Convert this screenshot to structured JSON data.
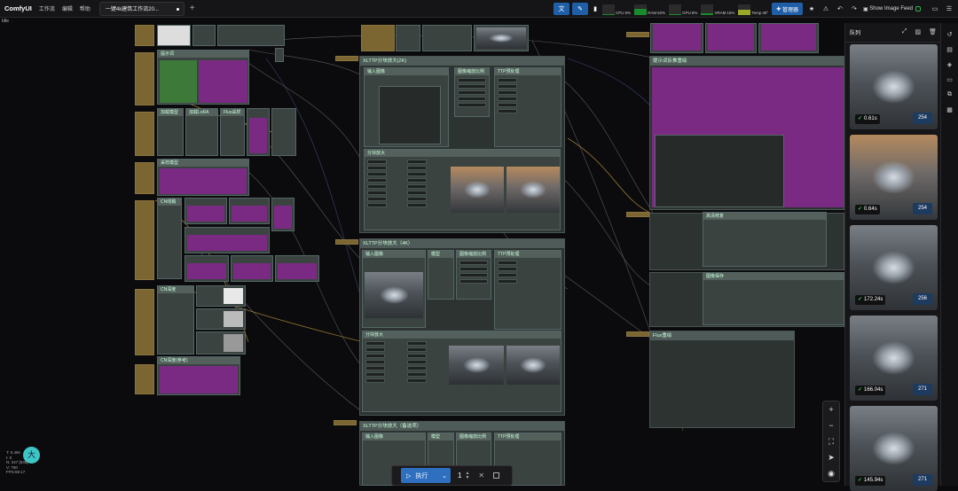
{
  "topbar": {
    "app_name": "ComfyUI",
    "menus": [
      "工作流",
      "编辑",
      "帮助"
    ],
    "tab_title": "一键4k建筑工作流20...",
    "stats": [
      {
        "label": "CPU",
        "value": "5%",
        "percent": 5
      },
      {
        "label": "RAM",
        "value": "62%",
        "percent": 62
      },
      {
        "label": "GPU",
        "value": "8%",
        "percent": 8
      },
      {
        "label": "VRAM",
        "value": "15%",
        "percent": 15
      },
      {
        "label": "Temp",
        "value": "48°",
        "percent": 48
      }
    ],
    "manager_label": "管理器",
    "show_feed_label": "Show Image Feed"
  },
  "status": "Idle",
  "queue": {
    "title": "队列",
    "items": [
      {
        "time": "0.61s",
        "count": "254",
        "style": "day"
      },
      {
        "time": "0.64s",
        "count": "254",
        "style": "sunset"
      },
      {
        "time": "172.24s",
        "count": "256",
        "style": "day"
      },
      {
        "time": "166.04s",
        "count": "271",
        "style": "day"
      },
      {
        "time": "145.94s",
        "count": "271",
        "style": "day"
      }
    ]
  },
  "run": {
    "label": "执行",
    "batch": "1"
  },
  "avatar_letter": "大",
  "coords": [
    "T: 0.49s",
    "I: 0",
    "N: 347 [535]",
    "V: 760",
    "FPS:59.17"
  ],
  "groups": {
    "g1": "XLTTP分块放大(2K)",
    "g1a": "输入图像",
    "g1b": "图像缩放比例",
    "g1c": "TTP预处理",
    "g1d": "分块放大",
    "g2": "XLTTP分块放大（4K）",
    "g2a": "输入图像",
    "g2b": "模型",
    "g2c": "图像缩放比例",
    "g2d": "TTP预处理",
    "g2e": "分块放大",
    "g3": "XLTTP分块放大（备选项）",
    "g3a": "输入图像",
    "g3b": "模型",
    "g3c": "图像缩放比例",
    "g3d": "TTP预处理",
    "r1": "提示词反推重绘",
    "r2": "高清修复",
    "r3": "图像保存",
    "r4": "Flux重绘",
    "l1": "提示词",
    "l2": "加载模型",
    "l3": "加载LoRA",
    "l4": "Flux采样",
    "l5": "采样模型",
    "l6": "CN线稿",
    "l7": "CN深度",
    "l8": "CN图像预处理",
    "l9": "输出尺寸",
    "l10": "LoRA组",
    "l11": "CN深度(参考)"
  }
}
